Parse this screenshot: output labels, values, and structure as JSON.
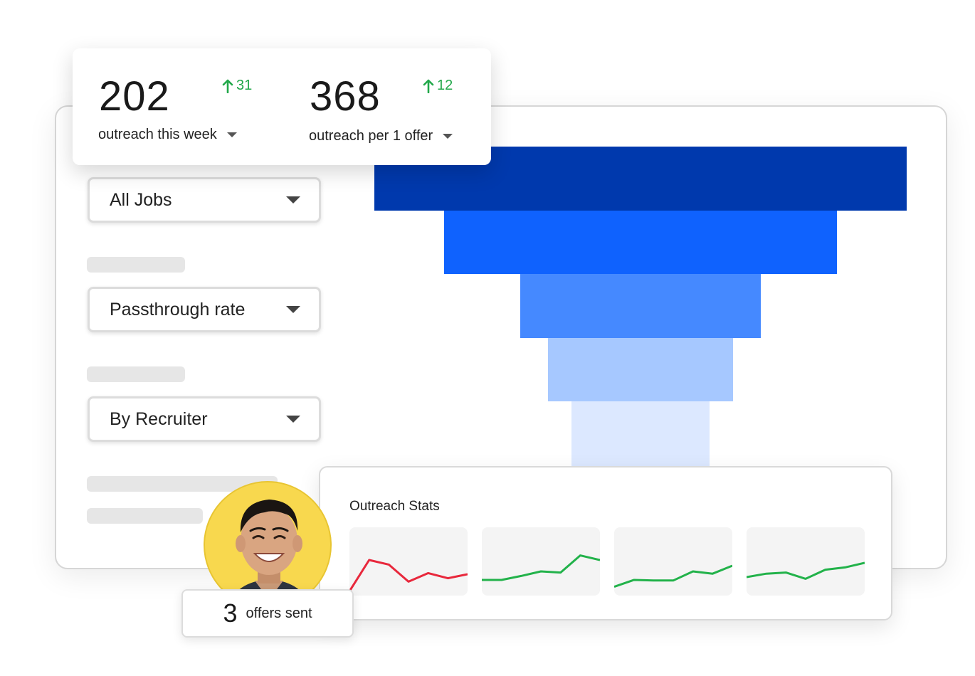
{
  "metrics": [
    {
      "value": "202",
      "delta": "31",
      "label": "outreach this week"
    },
    {
      "value": "368",
      "delta": "12",
      "label": "outreach per 1 offer"
    }
  ],
  "filters": {
    "jobs": "All Jobs",
    "metric": "Passthrough rate",
    "grouping": "By Recruiter"
  },
  "funnel": {
    "stages": [
      {
        "relative_width": 1.0,
        "color": "#0039ad"
      },
      {
        "relative_width": 0.737,
        "color": "#0f62fe"
      },
      {
        "relative_width": 0.453,
        "color": "#4589ff"
      },
      {
        "relative_width": 0.348,
        "color": "#a6c8ff"
      },
      {
        "relative_width": 0.259,
        "color": "#dce8ff"
      }
    ]
  },
  "outreach_stats": {
    "title": "Outreach Stats",
    "sparklines": [
      {
        "color": "#e8283c",
        "values": [
          0.0,
          0.55,
          0.47,
          0.17,
          0.32,
          0.23,
          0.3
        ]
      },
      {
        "color": "#22b24a",
        "values": [
          0.2,
          0.2,
          0.27,
          0.35,
          0.33,
          0.63,
          0.55
        ]
      },
      {
        "color": "#22b24a",
        "values": [
          0.08,
          0.2,
          0.19,
          0.19,
          0.35,
          0.31,
          0.45
        ]
      },
      {
        "color": "#22b24a",
        "values": [
          0.25,
          0.31,
          0.33,
          0.22,
          0.38,
          0.42,
          0.5
        ]
      }
    ]
  },
  "offers": {
    "count": "3",
    "label": "offers sent"
  },
  "colors": {
    "accent_up": "#22a84a",
    "avatar_bg": "#f8d84e"
  },
  "icons": {
    "delta": "arrow-up-icon",
    "dropdown": "caret-down-icon"
  }
}
